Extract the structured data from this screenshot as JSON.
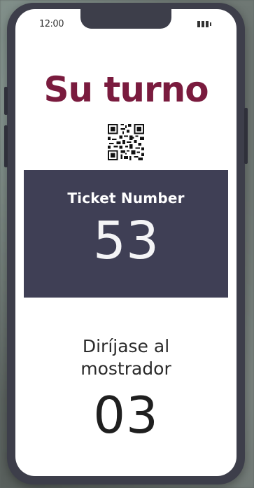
{
  "status_bar": {
    "time": "12:00",
    "battery_icon": "battery-icon"
  },
  "screen": {
    "title": "Su turno",
    "qr_icon": "qr-code-icon",
    "ticket": {
      "label": "Ticket Number",
      "number": "53"
    },
    "counter": {
      "label_line1": "Diríjase al",
      "label_line2": "mostrador",
      "number": "03"
    }
  },
  "colors": {
    "title": "#7a1b3e",
    "panel": "#3f3f55",
    "phone_frame": "#3d3e4a"
  }
}
